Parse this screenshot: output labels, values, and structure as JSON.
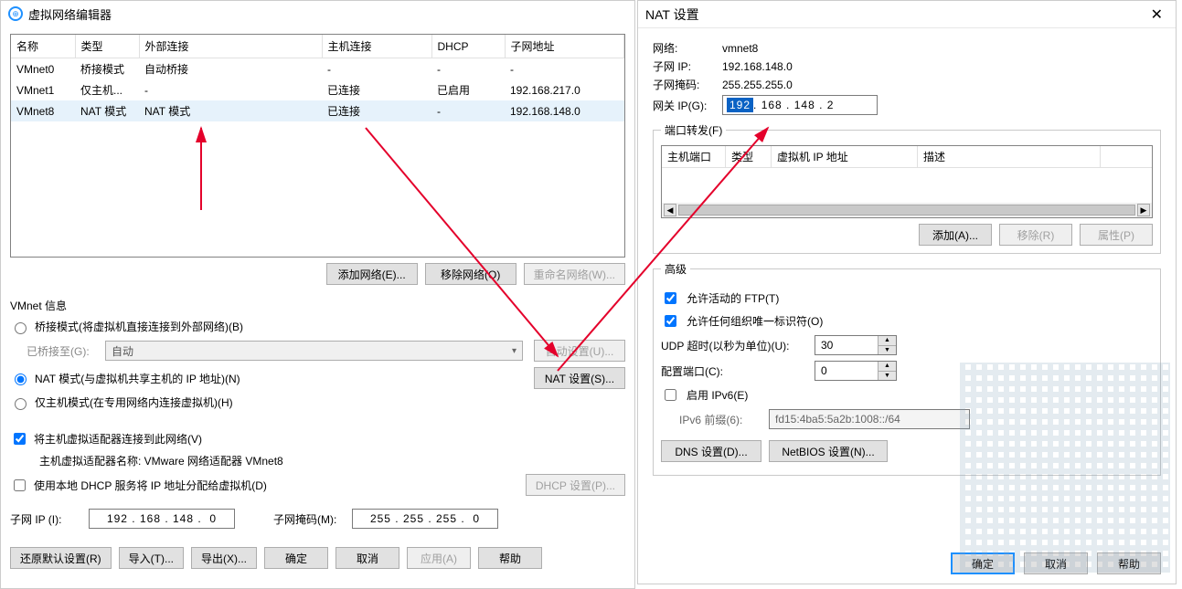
{
  "vne": {
    "title": "虚拟网络编辑器",
    "table": {
      "headers": [
        "名称",
        "类型",
        "外部连接",
        "主机连接",
        "DHCP",
        "子网地址"
      ],
      "rows": [
        {
          "name": "VMnet0",
          "type": "桥接模式",
          "ext": "自动桥接",
          "host": "-",
          "dhcp": "-",
          "subnet": "-"
        },
        {
          "name": "VMnet1",
          "type": "仅主机...",
          "ext": "-",
          "host": "已连接",
          "dhcp": "已启用",
          "subnet": "192.168.217.0"
        },
        {
          "name": "VMnet8",
          "type": "NAT 模式",
          "ext": "NAT 模式",
          "host": "已连接",
          "dhcp": "-",
          "subnet": "192.168.148.0"
        }
      ]
    },
    "buttons_row": {
      "add": "添加网络(E)...",
      "remove": "移除网络(O)",
      "rename": "重命名网络(W)..."
    },
    "info_title": "VMnet 信息",
    "radio_bridge": "桥接模式(将虚拟机直接连接到外部网络)(B)",
    "bridge_to_label": "已桥接至(G):",
    "bridge_to_value": "自动",
    "auto_settings": "自动设置(U)...",
    "radio_nat": "NAT 模式(与虚拟机共享主机的 IP 地址)(N)",
    "nat_settings": "NAT 设置(S)...",
    "radio_host": "仅主机模式(在专用网络内连接虚拟机)(H)",
    "check_connect": "将主机虚拟适配器连接到此网络(V)",
    "adapter_name_label": "主机虚拟适配器名称: VMware 网络适配器 VMnet8",
    "check_dhcp": "使用本地 DHCP 服务将 IP 地址分配给虚拟机(D)",
    "dhcp_settings": "DHCP 设置(P)...",
    "subnet_ip_label": "子网 IP (I):",
    "subnet_ip_value": "192 . 168 . 148 .  0",
    "subnet_mask_label": "子网掩码(M):",
    "subnet_mask_value": "255 . 255 . 255 .  0",
    "bottom": {
      "restore": "还原默认设置(R)",
      "import": "导入(T)...",
      "export": "导出(X)...",
      "ok": "确定",
      "cancel": "取消",
      "apply": "应用(A)",
      "help": "帮助"
    }
  },
  "nat": {
    "title": "NAT 设置",
    "network_label": "网络:",
    "network_value": "vmnet8",
    "subnet_label": "子网 IP:",
    "subnet_value": "192.168.148.0",
    "mask_label": "子网掩码:",
    "mask_value": "255.255.255.0",
    "gw_label": "网关 IP(G):",
    "gw_value_sel": "192",
    "gw_value_rest": " . 168 . 148 .  2",
    "pf_title": "端口转发(F)",
    "pf_headers": {
      "c1": "主机端口",
      "c2": "类型",
      "c3": "虚拟机 IP 地址",
      "c4": "描述"
    },
    "pf_buttons": {
      "add": "添加(A)...",
      "remove": "移除(R)",
      "props": "属性(P)"
    },
    "adv_title": "高级",
    "check_ftp": "允许活动的 FTP(T)",
    "check_oui": "允许任何组织唯一标识符(O)",
    "udp_label": "UDP 超时(以秒为单位)(U):",
    "udp_value": "30",
    "cfg_port_label": "配置端口(C):",
    "cfg_port_value": "0",
    "check_ipv6": "启用 IPv6(E)",
    "ipv6_prefix_label": "IPv6 前缀(6):",
    "ipv6_prefix_value": "fd15:4ba5:5a2b:1008::/64",
    "dns_btn": "DNS 设置(D)...",
    "netbios_btn": "NetBIOS 设置(N)...",
    "ok": "确定",
    "cancel": "取消",
    "help": "帮助"
  }
}
